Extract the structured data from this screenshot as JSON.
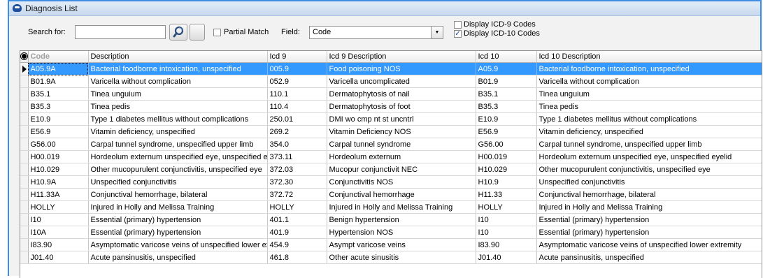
{
  "window": {
    "title": "Diagnosis List"
  },
  "search": {
    "label": "Search for:",
    "value": "",
    "placeholder": ""
  },
  "partial_match": {
    "label": "Partial Match",
    "checked": false
  },
  "field": {
    "label": "Field:",
    "selected": "Code"
  },
  "display_icd9": {
    "label": "Display ICD-9 Codes",
    "checked": false
  },
  "display_icd10": {
    "label": "Display ICD-10 Codes",
    "checked": true
  },
  "grid": {
    "columns": [
      "Code",
      "Description",
      "Icd 9",
      "Icd 9 Description",
      "Icd 10",
      "Icd 10 Description"
    ],
    "rows": [
      [
        "A05.9A",
        "Bacterial foodborne intoxication, unspecified",
        "005.9",
        "Food poisoning NOS",
        "A05.9",
        "Bacterial foodborne intoxication, unspecified"
      ],
      [
        "B01.9A",
        "Varicella without complication",
        "052.9",
        "Varicella uncomplicated",
        "B01.9",
        "Varicella without complication"
      ],
      [
        "B35.1",
        "Tinea unguium",
        "110.1",
        "Dermatophytosis of nail",
        "B35.1",
        "Tinea unguium"
      ],
      [
        "B35.3",
        "Tinea pedis",
        "110.4",
        "Dermatophytosis of foot",
        "B35.3",
        "Tinea pedis"
      ],
      [
        "E10.9",
        "Type 1 diabetes mellitus without complications",
        "250.01",
        "DMI wo cmp nt st uncntrl",
        "E10.9",
        "Type 1 diabetes mellitus without complications"
      ],
      [
        "E56.9",
        "Vitamin deficiency, unspecified",
        "269.2",
        "Vitamin Deficiency NOS",
        "E56.9",
        "Vitamin deficiency, unspecified"
      ],
      [
        "G56.00",
        "Carpal tunnel syndrome, unspecified upper limb",
        "354.0",
        "Carpal tunnel syndrome",
        "G56.00",
        "Carpal tunnel syndrome, unspecified upper limb"
      ],
      [
        "H00.019",
        "Hordeolum externum unspecified eye, unspecified eyelid",
        "373.11",
        "Hordeolum externum",
        "H00.019",
        "Hordeolum externum unspecified eye, unspecified eyelid"
      ],
      [
        "H10.029",
        "Other mucopurulent conjunctivitis, unspecified eye",
        "372.03",
        "Mucopur conjunctivit NEC",
        "H10.029",
        "Other mucopurulent conjunctivitis, unspecified eye"
      ],
      [
        "H10.9A",
        "Unspecified conjunctivitis",
        "372.30",
        "Conjunctivitis NOS",
        "H10.9",
        "Unspecified conjunctivitis"
      ],
      [
        "H11.33A",
        "Conjunctival hemorrhage, bilateral",
        "372.72",
        "Conjunctival hemorrhage",
        "H11.33",
        "Conjunctival hemorrhage, bilateral"
      ],
      [
        "HOLLY",
        "Injured in Holly and Melissa Training",
        "HOLLY",
        "Injured in Holly and Melissa Training",
        "HOLLY",
        "Injured in Holly and Melissa Training"
      ],
      [
        "I10",
        "Essential (primary) hypertension",
        "401.1",
        "Benign hypertension",
        "I10",
        "Essential (primary) hypertension"
      ],
      [
        "I10A",
        "Essential (primary) hypertension",
        "401.9",
        "Hypertension NOS",
        "I10",
        "Essential (primary) hypertension"
      ],
      [
        "I83.90",
        "Asymptomatic varicose veins of unspecified lower extremity",
        "454.9",
        "Asympt varicose veins",
        "I83.90",
        "Asymptomatic varicose veins of unspecified lower extremity"
      ],
      [
        "J01.40",
        "Acute pansinusitis, unspecified",
        "461.8",
        "Other acute sinusitis",
        "J01.40",
        "Acute pansinusitis, unspecified"
      ]
    ],
    "selected_row": 0
  },
  "colors": {
    "selection": "#3399ff",
    "frame_border": "#3f8ee6"
  },
  "icons": {
    "app": "app-logo-icon",
    "search_button": "binoculars-icon",
    "record_indicator": "current-row-arrow-icon"
  }
}
